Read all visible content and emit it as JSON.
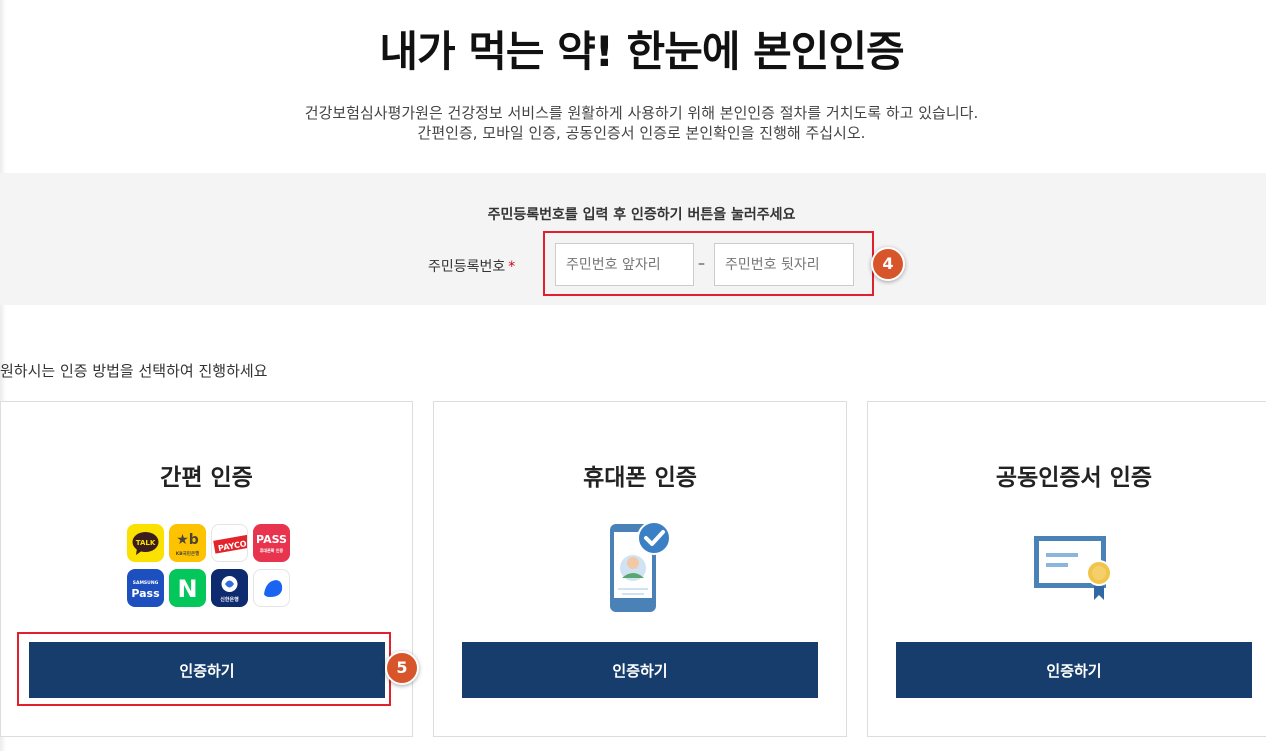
{
  "page": {
    "title": "내가 먹는 약! 한눈에 본인인증",
    "desc_line1": "건강보험심사평가원은 건강정보 서비스를 원활하게 사용하기 위해 본인인증 절차를 거치도록 하고 있습니다.",
    "desc_line2": "간편인증, 모바일 인증, 공동인증서 인증로 본인확인을 진행해 주십시오."
  },
  "input_panel": {
    "guide": "주민등록번호를 입력 후 인증하기 버튼을 눌러주세요",
    "label": "주민등록번호",
    "required_mark": "*",
    "front_placeholder": "주민번호 앞자리",
    "back_placeholder": "주민번호 뒷자리",
    "separator": "–"
  },
  "annotations": {
    "step_input": "4",
    "step_button": "5",
    "highlight_color": "#e0202c",
    "badge_color": "#d8552b"
  },
  "methods": {
    "guide": "원하시는 인증 방법을 선택하여 진행하세요",
    "cards": [
      {
        "title": "간편 인증",
        "button": "인증하기",
        "icon": "app-logos-grid"
      },
      {
        "title": "휴대폰 인증",
        "button": "인증하기",
        "icon": "mobile-phone-verified-icon"
      },
      {
        "title": "공동인증서 인증",
        "button": "인증하기",
        "icon": "certificate-icon"
      }
    ],
    "simple_auth_apps": [
      {
        "name": "kakaotalk",
        "label": "TALK"
      },
      {
        "name": "kb-bank",
        "label": "KB국민은행"
      },
      {
        "name": "payco",
        "label": "PAYCO"
      },
      {
        "name": "pass",
        "label": "PASS",
        "sublabel": "휴대폰확 인증"
      },
      {
        "name": "samsung-pass",
        "label": "SAMSUNG",
        "sublabel": "Pass"
      },
      {
        "name": "naver",
        "label": "N"
      },
      {
        "name": "shinhan-bank",
        "label": "신한은행"
      },
      {
        "name": "toss",
        "label": ""
      }
    ]
  },
  "colors": {
    "button_bg": "#163d6b",
    "panel_bg": "#f4f4f4"
  }
}
